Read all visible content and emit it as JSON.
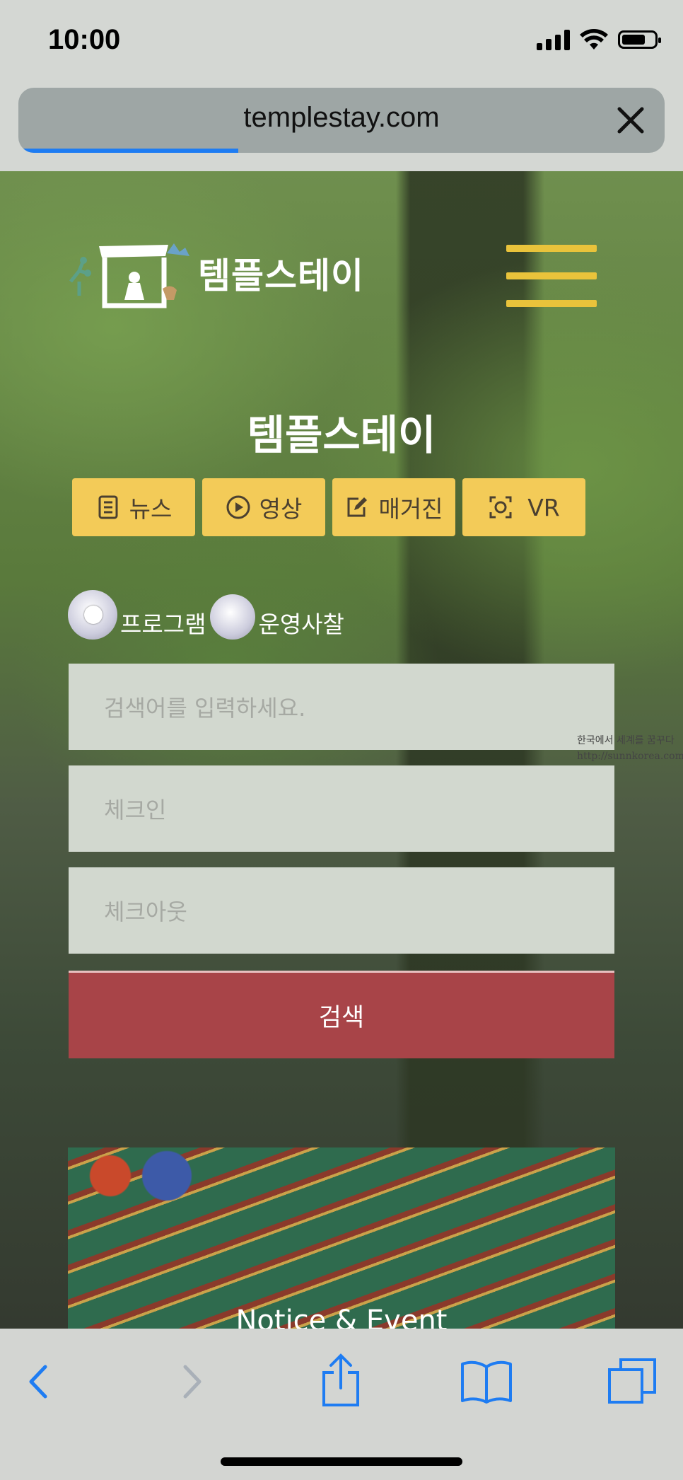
{
  "status_bar": {
    "time": "10:00"
  },
  "browser": {
    "url": "templestay.com",
    "load_progress": 0.34
  },
  "site": {
    "logo_text": "템플스테이",
    "hero_title": "템플스테이",
    "categories": [
      {
        "label": "뉴스",
        "icon": "document-icon"
      },
      {
        "label": "영상",
        "icon": "play-icon"
      },
      {
        "label": "매거진",
        "icon": "edit-icon"
      },
      {
        "label": "VR",
        "icon": "vr-icon"
      }
    ],
    "search_type": {
      "options": [
        "프로그램",
        "운영사찰"
      ],
      "selected": "프로그램"
    },
    "search": {
      "keyword_placeholder": "검색어를 입력하세요.",
      "checkin_placeholder": "체크인",
      "checkout_placeholder": "체크아웃",
      "button_label": "검색"
    },
    "notice_title": "Notice & Event",
    "watermark": [
      "한국에서 세계를 꿈꾸다",
      "http://sunnkorea.com"
    ]
  },
  "colors": {
    "accent_yellow": "#f3cb58",
    "search_button": "#a84448",
    "progress": "#1e7cf2"
  }
}
